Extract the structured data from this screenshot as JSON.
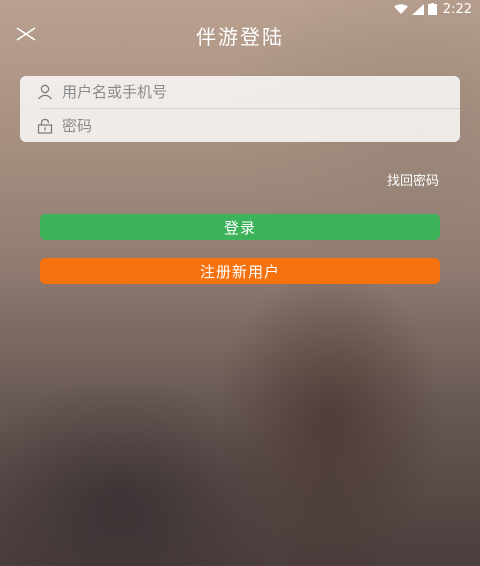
{
  "status_bar": {
    "time": "2:22"
  },
  "header": {
    "title": "伴游登陆"
  },
  "form": {
    "username_placeholder": "用户名或手机号",
    "password_placeholder": "密码"
  },
  "links": {
    "forgot_password": "找回密码"
  },
  "buttons": {
    "login": "登录",
    "register": "注册新用户"
  },
  "colors": {
    "login_button": "#3cb35b",
    "register_button": "#f6720f"
  },
  "icons": [
    "close-icon",
    "user-icon",
    "lock-icon",
    "wifi-icon",
    "signal-icon",
    "battery-icon"
  ]
}
